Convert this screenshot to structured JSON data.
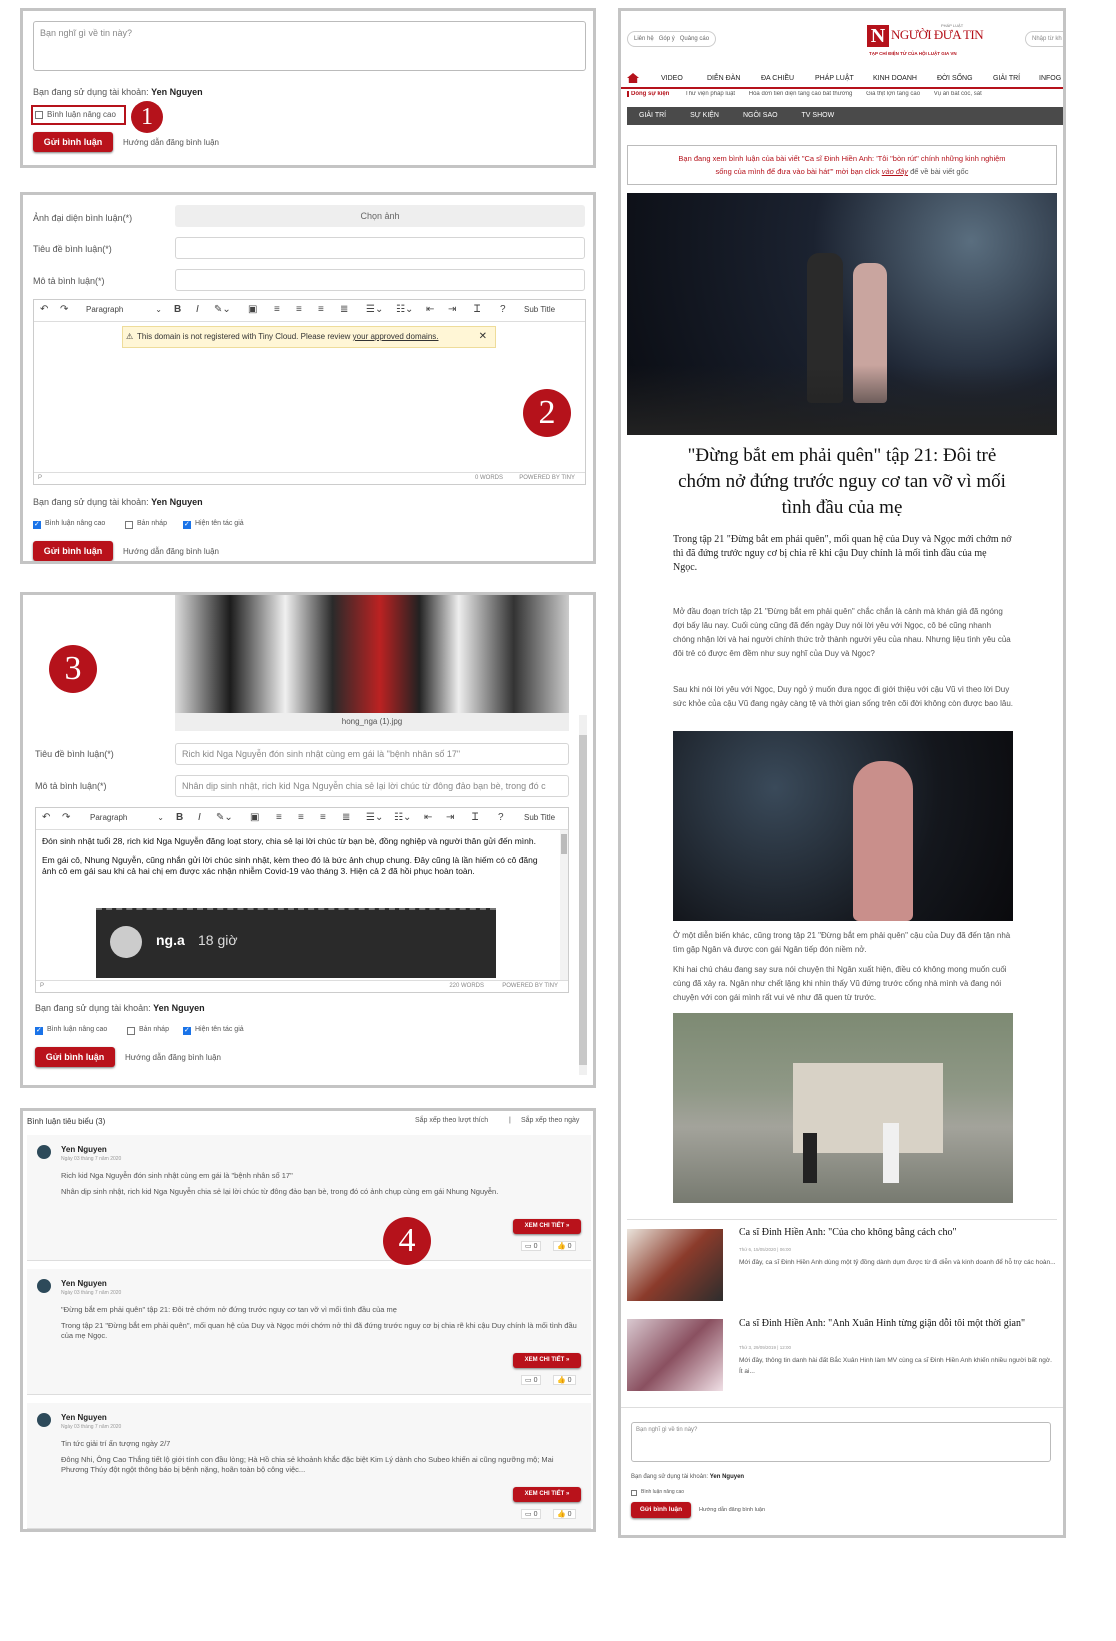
{
  "badges": [
    "1",
    "2",
    "3",
    "4"
  ],
  "panel1": {
    "placeholder": "Bạn nghĩ gì về tin này?",
    "account_label": "Bạn đang sử dụng tài khoản:",
    "account_name": "Yen Nguyen",
    "advanced_label": "Bình luận nâng cao",
    "submit": "Gửi bình luận",
    "guide": "Hướng dẫn đăng bình luận"
  },
  "panel2": {
    "avatar_label": "Ảnh đại diện bình luận(*)",
    "choose_image": "Chọn ảnh",
    "title_label": "Tiêu đề bình luận(*)",
    "desc_label": "Mô tả bình luận(*)",
    "paragraph": "Paragraph",
    "subtitle": "Sub Title",
    "warning_text": "This domain is not registered with Tiny Cloud. Please review",
    "warning_link": "your approved domains.",
    "path": "P",
    "word_count": "0 WORDS",
    "powered": "POWERED BY TINY",
    "account_label": "Bạn đang sử dụng tài khoản:",
    "account_name": "Yen Nguyen",
    "opt_advanced": "Bình luận nâng cao",
    "opt_draft": "Bản nháp",
    "opt_author": "Hiện tên tác giả",
    "submit": "Gửi bình luận",
    "guide": "Hướng dẫn đăng bình luận"
  },
  "panel3": {
    "image_caption": "hong_nga (1).jpg",
    "title_label": "Tiêu đề bình luận(*)",
    "title_value": "Rich kid Nga Nguyễn đón sinh nhật cùng em gái là \"bệnh nhân số 17\"",
    "desc_label": "Mô tả bình luận(*)",
    "desc_value": "Nhân dịp sinh nhật, rich kid Nga Nguyễn chia sẻ lại lời chúc từ đông đảo bạn bè, trong đó c",
    "paragraph": "Paragraph",
    "subtitle": "Sub Title",
    "body1": "Đón sinh nhật tuổi 28, rich kid Nga Nguyễn đăng loạt story, chia sẻ lại lời chúc từ bạn bè, đồng nghiệp và người thân gửi đến mình.",
    "body2": "Em gái cô, Nhung Nguyễn, cũng nhắn gửi lời chúc sinh nhật, kèm theo đó là bức ảnh chụp chung. Đây cũng là lần hiếm có cô đăng ảnh cô em gái sau khi cả hai chị em được xác nhận nhiễm Covid-19 vào tháng 3. Hiện cả 2 đã hồi phục hoàn toàn.",
    "embed_user": "ng.a",
    "embed_time": "18 giờ",
    "path": "P",
    "word_count": "220 WORDS",
    "powered": "POWERED BY TINY",
    "account_label": "Bạn đang sử dụng tài khoản:",
    "account_name": "Yen Nguyen",
    "opt_advanced": "Bình luận nâng cao",
    "opt_draft": "Bản nháp",
    "opt_author": "Hiện tên tác giả",
    "submit": "Gửi bình luận",
    "guide": "Hướng dẫn đăng bình luận"
  },
  "panel4": {
    "heading": "Bình luận tiêu biểu (3)",
    "sort_like": "Sắp xếp theo lượt thích",
    "sep": "|",
    "sort_date": "Sắp xếp theo ngày",
    "comments": [
      {
        "author": "Yen Nguyen",
        "date": "Ngày 03 tháng 7 năm 2020",
        "title": "Rich kid Nga Nguyễn đón sinh nhật cùng em gái là \"bệnh nhân số 17\"",
        "body": "Nhân dịp sinh nhật, rich kid Nga Nguyễn chia sẻ lại lời chúc từ đông đảo bạn bè, trong đó có ảnh chụp cùng em gái Nhung Nguyễn.",
        "more": "XEM CHI TIẾT »",
        "c1": "0",
        "c2": "0"
      },
      {
        "author": "Yen Nguyen",
        "date": "Ngày 03 tháng 7 năm 2020",
        "title": "\"Đừng bắt em phải quên\" tập 21: Đôi trẻ chớm nở đứng trước nguy cơ tan vỡ vì mối tình đầu của mẹ",
        "body": "Trong tập 21 \"Đừng bắt em phải quên\", mối quan hệ của Duy và Ngọc mới chớm nở thì đã đứng trước nguy cơ bị chia rẽ khi cậu Duy chính là mối tình đầu của mẹ Ngọc.",
        "more": "XEM CHI TIẾT »",
        "c1": "0",
        "c2": "0"
      },
      {
        "author": "Yen Nguyen",
        "date": "Ngày 03 tháng 7 năm 2020",
        "title": "Tin tức giải trí ấn tượng ngày 2/7",
        "body": "Đông Nhi, Ông Cao Thắng tiết lộ giới tính con đầu lòng; Hà Hồ chia sẻ khoảnh khắc đặc biệt Kim Lý dành cho Subeo khiến ai cũng ngưỡng mộ; Mai Phương Thúy đột ngột thông báo bị bệnh nặng, hoãn toàn bộ công việc...",
        "more": "XEM CHI TIẾT »",
        "c1": "0",
        "c2": "0"
      }
    ]
  },
  "site": {
    "top_links": [
      "Liên hệ",
      "Góp ý",
      "Quảng cáo"
    ],
    "logo_main": "NGƯỜI ĐƯA TIN",
    "logo_small": "PHÁP LUẬT",
    "tagline": "TẠP CHÍ ĐIỆN TỬ CỦA HỘI LUẬT GIA VN",
    "search_placeholder": "Nhập từ kh",
    "nav": [
      "VIDEO",
      "DIỄN ĐÀN",
      "ĐA CHIỀU",
      "PHÁP LUẬT",
      "KINH DOANH",
      "ĐỜI SỐNG",
      "GIẢI TRÍ",
      "INFOG"
    ],
    "event_label": "Dòng sự kiện",
    "events": [
      "Thư viện pháp luật",
      "Hóa đơn tiền điện tăng cao bất thường",
      "Giá thịt lợn tăng cao",
      "Vụ án bắt cóc, sát"
    ],
    "subnav": [
      "GIẢI TRÍ",
      "SỰ KIỆN",
      "NGÔI SAO",
      "TV SHOW"
    ],
    "notice1": "Bạn đang xem bình luận của bài viết \"Ca sĩ Đinh Hiền Anh: 'Tôi \"bòn rút\" chính những kinh nghiệm",
    "notice2": "sống của mình để đưa vào bài hát'\" mời bạn click",
    "notice_link": "vào đây",
    "notice3": "để về bài viết gốc",
    "headline": "\"Đừng bắt em phải quên\" tập 21: Đôi trẻ chớm nở đứng trước nguy cơ tan vỡ vì mối tình đầu của mẹ",
    "sapo": "Trong tập 21 \"Đừng bắt em phải quên\", mối quan hệ của Duy và Ngọc mới chớm nở thì đã đứng trước nguy cơ bị chia rẽ khi cậu Duy chính là mối tình đầu của mẹ Ngọc.",
    "p1": "Mở đầu đoạn trích tập 21 \"Đừng bắt em phải quên\" chắc chắn là cảnh mà khán giả đã ngóng đợi bấy lâu nay. Cuối cùng cũng đã đến ngày Duy nói lời yêu với Ngọc, cô bé cũng nhanh chóng nhận lời và hai người chính thức trở thành người yêu của nhau. Nhưng liệu tình yêu của đôi trẻ có được êm đềm như suy nghĩ của Duy và Ngọc?",
    "p2": "Sau khi nói lời yêu với Ngọc, Duy ngỏ ý muốn đưa ngọc đi giới thiệu với cậu Vũ vì theo lời Duy sức khỏe của cậu Vũ đang ngày càng tệ và thời gian sống trên cõi đời không còn được bao lâu.",
    "p3": "Ở một diễn biến khác, cũng trong tập 21 \"Đừng bắt em phải quên\" cậu của Duy đã đến tận nhà tìm gặp Ngân và được con gái Ngân tiếp đón niềm nở.",
    "p4": "Khi hai chú cháu đang say sưa nói chuyện thì Ngân xuất hiện, điều có không mong muốn cuối cùng đã xảy ra. Ngân như chết lặng khi nhìn thấy Vũ đứng trước cổng nhà mình và đang nói chuyện với con gái mình rất vui vẻ như đã quen từ trước.",
    "related": [
      {
        "title": "Ca sĩ Đinh Hiền Anh: \"Của cho không bằng cách cho\"",
        "date": "Thứ 6, 15/05/2020 | 06:00",
        "desc": "Mới đây, ca sĩ Đinh Hiền Anh dùng một tỷ đồng dành dụm được từ đi diễn và kinh doanh để hỗ trợ các hoàn..."
      },
      {
        "title": "Ca sĩ Đinh Hiền Anh: \"Anh Xuân Hinh từng giận dỗi tôi một thời gian\"",
        "date": "Thứ 3, 29/09/2019 | 12:00",
        "desc": "Mới đây, thông tin danh hài đất Bắc Xuân Hinh làm MV cùng ca sĩ Đinh Hiền Anh khiến nhiều người bất ngờ. Ít ai..."
      }
    ],
    "comment_placeholder": "Bạn nghĩ gì về tin này?",
    "account_label": "Bạn đang sử dụng tài khoản:",
    "account_name": "Yen Nguyen",
    "advanced_label": "Bình luận nâng cao",
    "submit": "Gửi bình luận",
    "guide": "Hướng dẫn đăng bình luận"
  }
}
